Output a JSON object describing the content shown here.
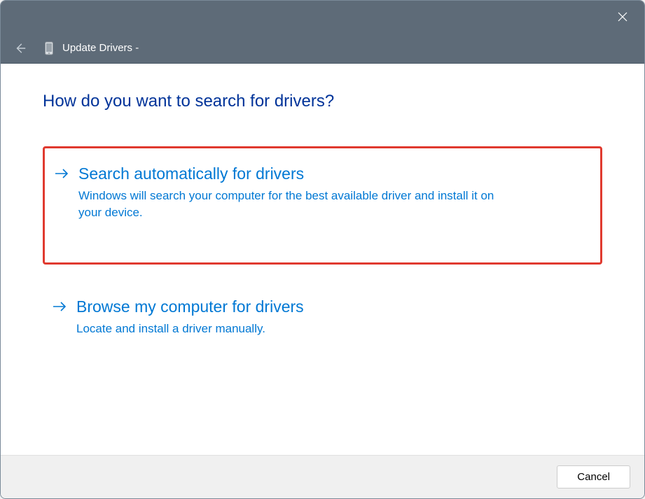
{
  "titlebar": {
    "window_title": "Update Drivers -"
  },
  "content": {
    "heading": "How do you want to search for drivers?"
  },
  "options": {
    "auto": {
      "title": "Search automatically for drivers",
      "desc": "Windows will search your computer for the best available driver and install it on your device."
    },
    "browse": {
      "title": "Browse my computer for drivers",
      "desc": "Locate and install a driver manually."
    }
  },
  "footer": {
    "cancel_label": "Cancel"
  }
}
